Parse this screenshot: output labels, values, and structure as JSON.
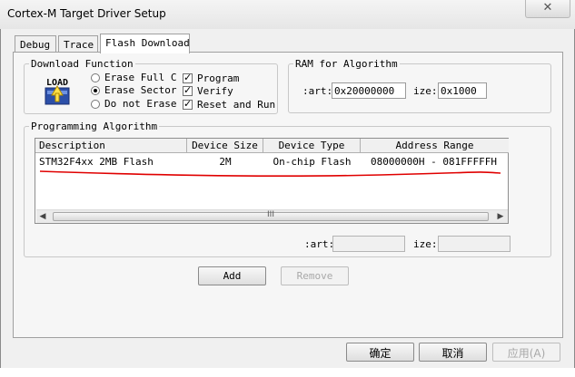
{
  "window": {
    "title": "Cortex-M Target Driver Setup",
    "close_glyph": "✕"
  },
  "tabs": [
    {
      "label": "Debug",
      "active": false
    },
    {
      "label": "Trace",
      "active": false
    },
    {
      "label": "Flash Download",
      "active": true
    }
  ],
  "download_function": {
    "legend": "Download Function",
    "icon_text": "LOAD",
    "icon": "load-icon",
    "radios": [
      {
        "label": "Erase Full C",
        "selected": false
      },
      {
        "label": "Erase Sector",
        "selected": true
      },
      {
        "label": "Do not Erase",
        "selected": false
      }
    ],
    "checks": [
      {
        "label": "Program",
        "checked": true
      },
      {
        "label": "Verify",
        "checked": true
      },
      {
        "label": "Reset and Run",
        "checked": true
      }
    ],
    "check_glyph": "✓"
  },
  "ram_for_algorithm": {
    "legend": "RAM for Algorithm",
    "start_label": ":art:",
    "start_value": "0x20000000",
    "size_label": "ize:",
    "size_value": "0x1000"
  },
  "programming_algorithm": {
    "legend": "Programming Algorithm",
    "columns": [
      "Description",
      "Device Size",
      "Device Type",
      "Address Range"
    ],
    "rows": [
      {
        "description": "STM32F4xx 2MB Flash",
        "size": "2M",
        "type": "On-chip Flash",
        "range": "08000000H - 081FFFFFH"
      }
    ],
    "annotation_color": "#e00000",
    "scroll": {
      "left": "◀",
      "right": "▶",
      "grip": "III"
    },
    "start_label": ":art:",
    "start_value": "",
    "size_label": "ize:",
    "size_value": "",
    "add_label": "Add",
    "remove_label": "Remove"
  },
  "footer": {
    "ok_label": "确定",
    "cancel_label": "取消",
    "apply_label": "应用(A)"
  }
}
